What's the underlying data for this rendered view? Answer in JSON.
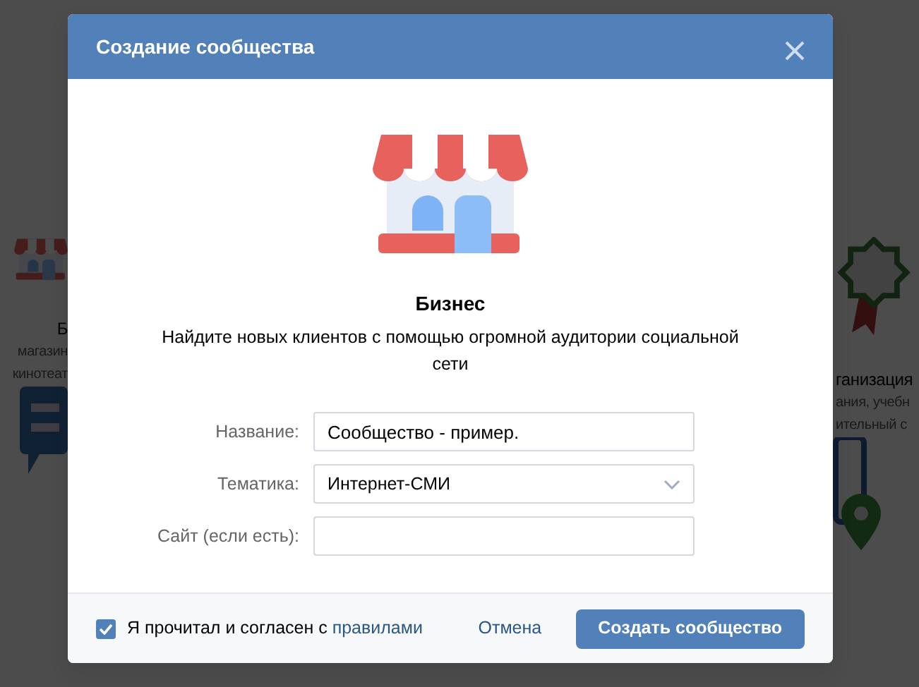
{
  "background": {
    "cards": [
      {
        "kind": "store",
        "title": "Б",
        "description": [
          "магазин",
          "кинотеат"
        ]
      },
      {
        "kind": "award",
        "title": "ганизация",
        "description": [
          "ания, учебн",
          "ительный с"
        ]
      }
    ]
  },
  "modal": {
    "title": "Создание сообщества",
    "category": {
      "title": "Бизнес",
      "description": "Найдите новых клиентов с помощью огромной аудитории социальной сети"
    },
    "fields": [
      {
        "kind": "text",
        "label": "Название:",
        "value": "Сообщество - пример."
      },
      {
        "kind": "select",
        "label": "Тематика:",
        "value": "Интернет-СМИ"
      },
      {
        "kind": "text",
        "label": "Сайт (если есть):"
      }
    ],
    "agreement": {
      "checked": true,
      "text": "Я прочитал и согласен с ",
      "link": "правилами"
    },
    "cancel": "Отмена",
    "submit": "Создать сообщество"
  }
}
